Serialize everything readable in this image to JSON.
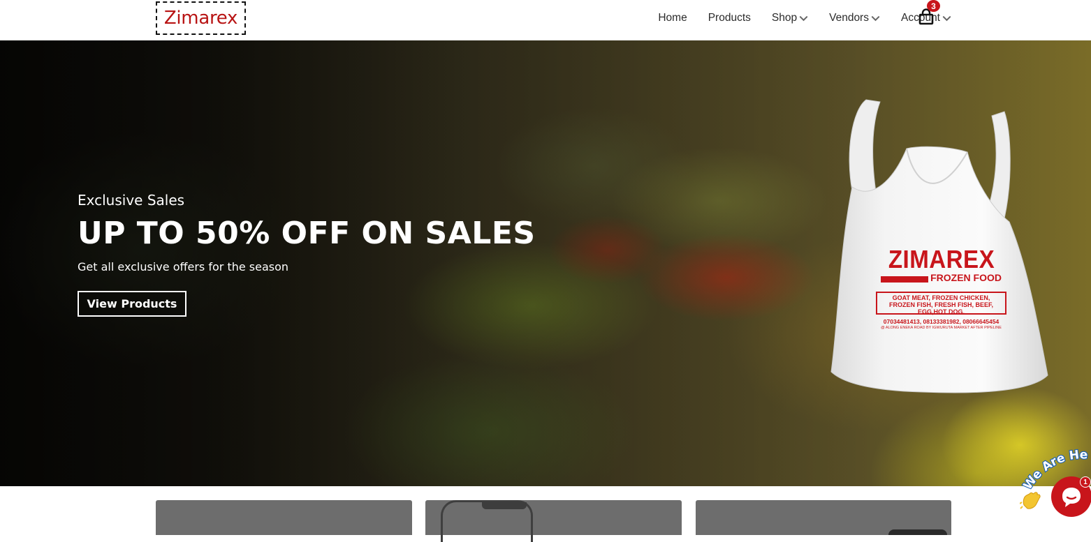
{
  "brand": {
    "logo_text": "Zimarex",
    "logo_color": "#b81414"
  },
  "nav": {
    "items": [
      {
        "label": "Home",
        "has_dropdown": false
      },
      {
        "label": "Products",
        "has_dropdown": false
      },
      {
        "label": "Shop",
        "has_dropdown": true
      },
      {
        "label": "Vendors",
        "has_dropdown": true
      },
      {
        "label": "Account",
        "has_dropdown": true
      }
    ],
    "cart_icon": "shopping-bag-icon",
    "cart_count": "3"
  },
  "hero": {
    "eyebrow": "Exclusive Sales",
    "headline": "UP TO 50% OFF ON SALES",
    "subline": "Get all exclusive offers for the season",
    "cta_label": "View Products",
    "bag": {
      "brand": "ZIMAREX",
      "tagline": "FROZEN FOOD",
      "items_line1": "GOAT MEAT, FROZEN CHICKEN,",
      "items_line2": "FROZEN FISH, FRESH FISH, BEEF,",
      "items_line3": "EGG,HOT DOG.",
      "phones": "07034481413, 08133381982, 08066645454",
      "address": "@ ALONG ENEKA ROAD BY IGWURUTA MARKET AFTER PIPELINE"
    }
  },
  "chat": {
    "teaser": "We Are Here",
    "badge_count": "1",
    "icon": "chat-bubble-icon",
    "accent": "#c8151b"
  }
}
